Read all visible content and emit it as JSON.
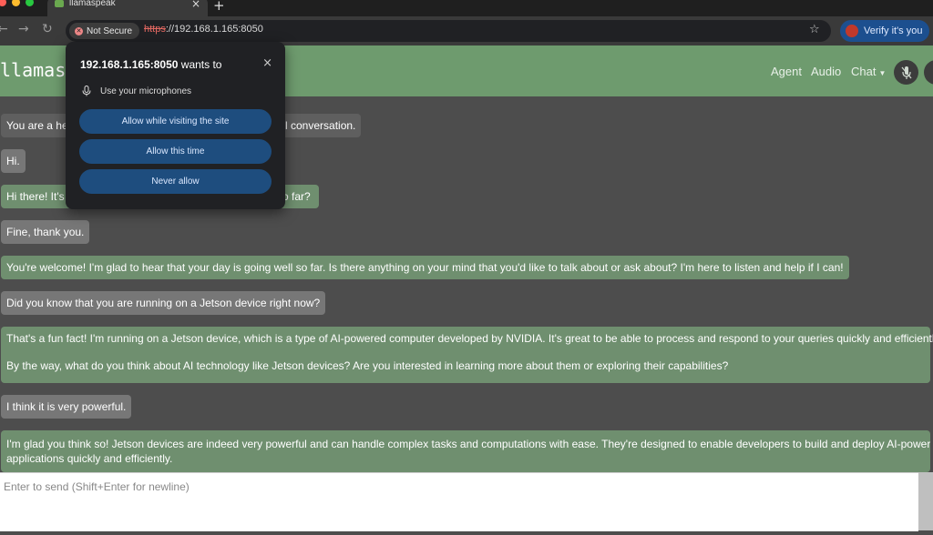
{
  "browser": {
    "tab_title": "llamaspeak",
    "tab_close": "×",
    "new_tab": "+",
    "security_chip": "Not Secure",
    "url_scheme": "https",
    "url_rest": "://192.168.1.165:8050",
    "profile_label": "Verify it's you",
    "traffic_light_colors": [
      "#ff5f57",
      "#febc2e",
      "#28c840"
    ]
  },
  "app": {
    "brand": "llamasp",
    "nav": {
      "agent": "Agent",
      "audio": "Audio",
      "chat": "Chat"
    },
    "header_color": "#6e9b6e"
  },
  "permission_prompt": {
    "host": "192.168.1.165:8050",
    "wants_to": " wants to",
    "close": "×",
    "permission": "Use your microphones",
    "buttons": {
      "allow_site": "Allow while visiting the site",
      "allow_once": "Allow this time",
      "never": "Never allow"
    }
  },
  "chat": {
    "messages": [
      {
        "role": "system",
        "text": "You are a hel"
      },
      {
        "role": "system_tail",
        "text": "l conversation."
      },
      {
        "role": "user",
        "text": "Hi."
      },
      {
        "role": "bot",
        "text": "Hi there! It's"
      },
      {
        "role": "bot_tail",
        "text": "so far?"
      },
      {
        "role": "user",
        "text": "Fine, thank you."
      },
      {
        "role": "bot",
        "text": "You're welcome! I'm glad to hear that your day is going well so far. Is there anything on your mind that you'd like to talk about or ask about? I'm here to listen and help if I can!"
      },
      {
        "role": "user",
        "text": "Did you know that you are running on a Jetson device right now?"
      },
      {
        "role": "bot",
        "text": "That's a fun fact! I'm running on a Jetson device, which is a type of AI-powered computer developed by NVIDIA. It's great to be able to process and respond to your queries quickly and efficiently!"
      },
      {
        "role": "bot",
        "text": "By the way, what do you think about AI technology like Jetson devices? Are you interested in learning more about them or exploring their capabilities?"
      },
      {
        "role": "user",
        "text": "I think it is very powerful."
      },
      {
        "role": "bot",
        "text": "I'm glad you think so! Jetson devices are indeed very powerful and can handle complex tasks and computations with ease. They're designed to enable developers to build and deploy AI-powered"
      },
      {
        "role": "bot",
        "text": "applications quickly and efficiently."
      }
    ]
  },
  "composer": {
    "placeholder": "Enter to send (Shift+Enter for newline)"
  }
}
